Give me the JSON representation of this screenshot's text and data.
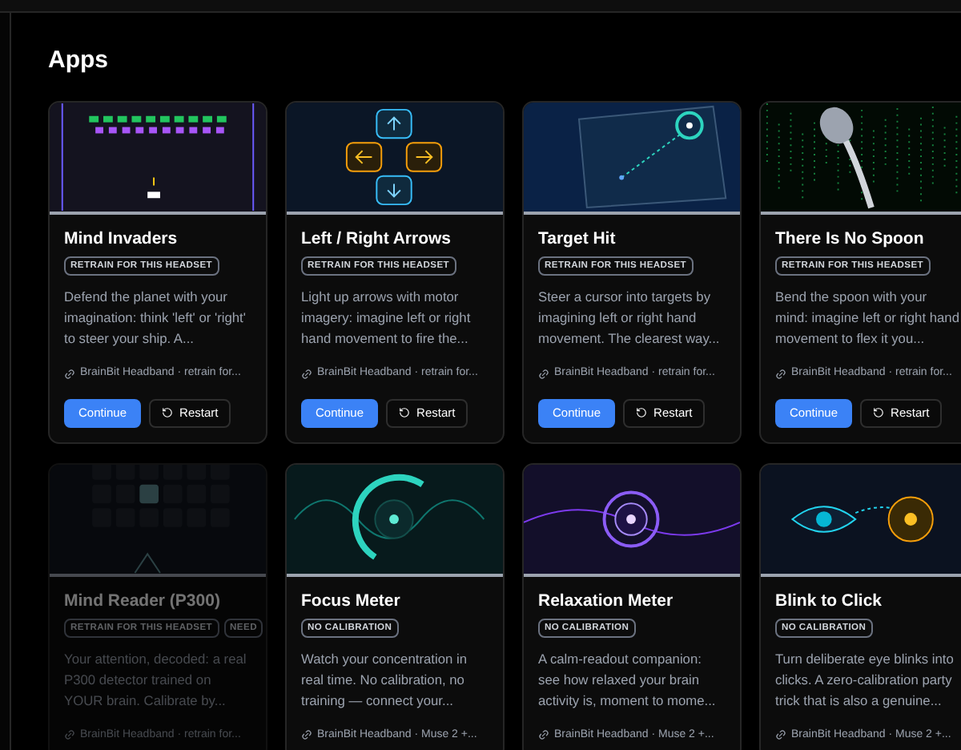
{
  "heading": "Apps",
  "rows": [
    {
      "cards": [
        {
          "kind": "invaders",
          "title": "Mind Invaders",
          "disabled": false,
          "badges": [
            "RETRAIN FOR THIS HEADSET"
          ],
          "description": "Defend the planet with your imagination: think 'left' or 'right' to steer your ship. A...",
          "footer": "BrainBit Headband · retrain for...",
          "buttons": [
            {
              "kind": "primary",
              "label": "Continue"
            },
            {
              "kind": "restart",
              "label": "Restart"
            }
          ]
        },
        {
          "kind": "arrows",
          "title": "Left / Right Arrows",
          "disabled": false,
          "badges": [
            "RETRAIN FOR THIS HEADSET"
          ],
          "description": "Light up arrows with motor imagery: imagine left or right hand movement to fire the...",
          "footer": "BrainBit Headband · retrain for...",
          "buttons": [
            {
              "kind": "primary",
              "label": "Continue"
            },
            {
              "kind": "restart",
              "label": "Restart"
            }
          ]
        },
        {
          "kind": "target",
          "title": "Target Hit",
          "disabled": false,
          "badges": [
            "RETRAIN FOR THIS HEADSET"
          ],
          "description": "Steer a cursor into targets by imagining left or right hand movement. The clearest way...",
          "footer": "BrainBit Headband · retrain for...",
          "buttons": [
            {
              "kind": "primary",
              "label": "Continue"
            },
            {
              "kind": "restart",
              "label": "Restart"
            }
          ]
        },
        {
          "kind": "spoon",
          "title": "There Is No Spoon",
          "disabled": false,
          "badges": [
            "RETRAIN FOR THIS HEADSET"
          ],
          "description": "Bend the spoon with your mind: imagine left or right hand movement to flex it you...",
          "footer": "BrainBit Headband · retrain for...",
          "buttons": [
            {
              "kind": "primary",
              "label": "Continue"
            },
            {
              "kind": "restart",
              "label": "Restart"
            }
          ]
        }
      ]
    },
    {
      "cards": [
        {
          "kind": "grid",
          "title": "Mind Reader (P300)",
          "disabled": true,
          "badges": [
            "RETRAIN FOR THIS HEADSET",
            "NEED"
          ],
          "description": "Your attention, decoded: a real P300 detector trained on YOUR brain. Calibrate by...",
          "footer": "BrainBit Headband · retrain for..."
        },
        {
          "kind": "focus",
          "title": "Focus Meter",
          "disabled": false,
          "badges": [
            "NO CALIBRATION"
          ],
          "description": "Watch your concentration in real time. No calibration, no training — connect your...",
          "footer": "BrainBit Headband · Muse 2 +..."
        },
        {
          "kind": "relax",
          "title": "Relaxation Meter",
          "disabled": false,
          "badges": [
            "NO CALIBRATION"
          ],
          "description": "A calm-readout companion: see how relaxed your brain activity is, moment to mome...",
          "footer": "BrainBit Headband · Muse 2 +..."
        },
        {
          "kind": "blink",
          "title": "Blink to Click",
          "disabled": false,
          "badges": [
            "NO CALIBRATION"
          ],
          "description": "Turn deliberate eye blinks into clicks. A zero-calibration party trick that is also a genuine...",
          "footer": "BrainBit Headband · Muse 2 +..."
        }
      ]
    }
  ]
}
